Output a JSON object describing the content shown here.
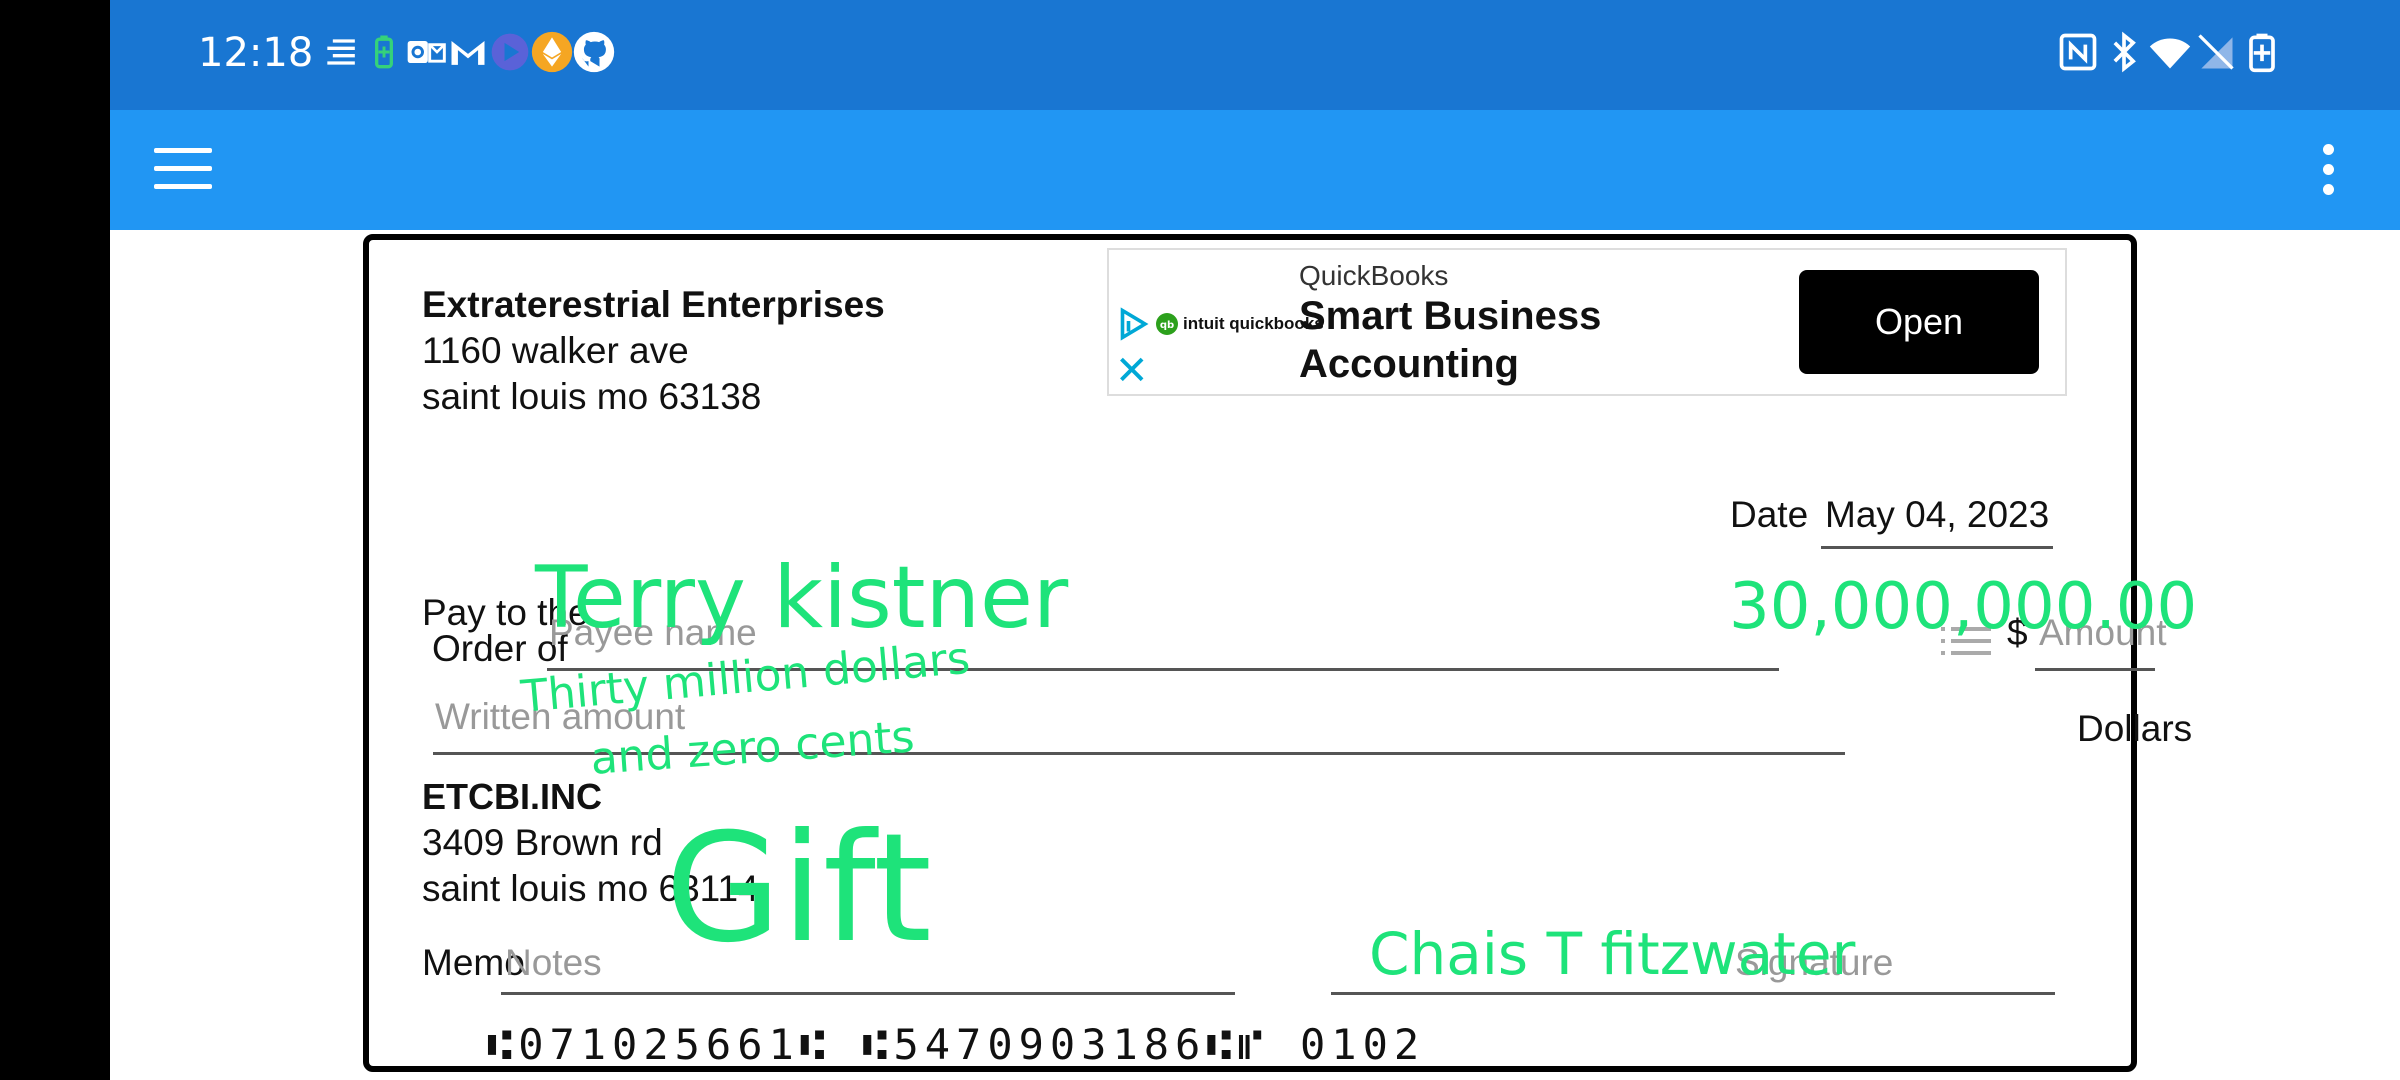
{
  "status_bar": {
    "time": "12:18",
    "left_icons": [
      "notification-lines-icon",
      "battery-saver-icon",
      "outlook-icon",
      "gmail-icon",
      "play-icon",
      "ethereum-icon",
      "github-icon"
    ],
    "right_icons": [
      "nfc-icon",
      "bluetooth-icon",
      "wifi-icon",
      "no-sim-icon",
      "battery-charging-icon"
    ]
  },
  "app_bar": {
    "menu_icon": "hamburger-icon",
    "overflow_icon": "more-vert-icon"
  },
  "check": {
    "payer": {
      "name": "Extraterestrial Enterprises",
      "address1": "1160 walker ave",
      "address2": "saint louis mo 63138"
    },
    "ad": {
      "brand_small": "intuit quickbooks",
      "advertiser": "QuickBooks",
      "headline1": "Smart Business",
      "headline2": "Accounting",
      "button": "Open",
      "close": "✕"
    },
    "date_label": "Date",
    "date_value": "May 04, 2023",
    "pay_label_1": "Pay to the",
    "pay_label_2": "Order of",
    "payee_placeholder": "Payee name",
    "payee_handwritten": "Terry kistner",
    "amount_handwritten": "30,000,000.00",
    "dollar_sign": "$",
    "amount_placeholder": "Amount",
    "written_placeholder": "Written amount",
    "written_handwritten_1": "Thirty million dollars",
    "written_handwritten_2": "and zero cents",
    "dollars_label": "Dollars",
    "bank": {
      "name": "ETCBI.INC",
      "address1": "3409 Brown rd",
      "address2": "saint louis mo 63114"
    },
    "memo_label": "Memo",
    "memo_placeholder": "Notes",
    "memo_handwritten": "Gift",
    "signature_placeholder": "Signature",
    "signature_handwritten": "Chais T fitzwater",
    "micr": "⑆071025661⑆ ⑆5470903186⑆⑈ 0102"
  },
  "colors": {
    "status_bar": "#1976d2",
    "app_bar": "#2196f3",
    "handwriting": "#1ee37a"
  }
}
